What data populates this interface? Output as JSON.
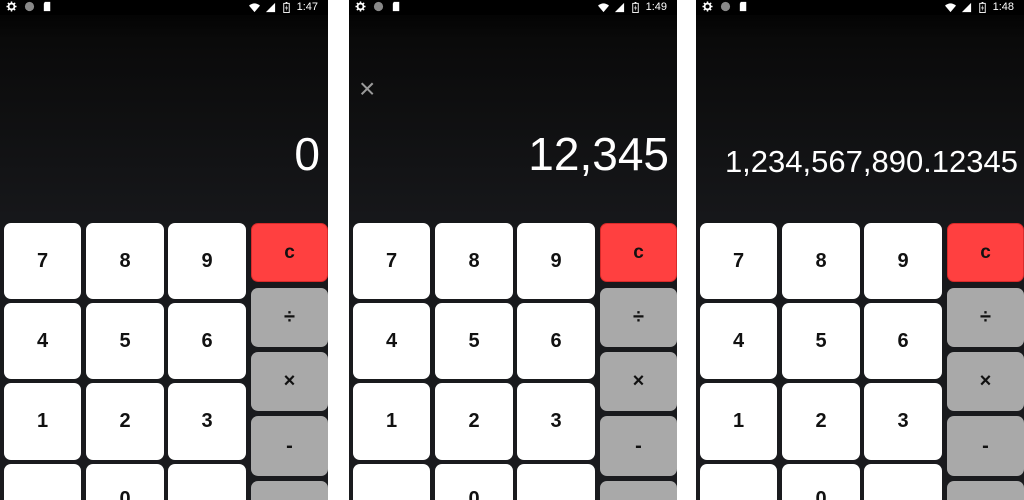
{
  "screens": [
    {
      "status": {
        "time": "1:47"
      },
      "operator": "",
      "display": "0",
      "keys": {
        "k7": "7",
        "k8": "8",
        "k9": "9",
        "clear": "c",
        "k4": "4",
        "k5": "5",
        "k6": "6",
        "divide": "÷",
        "k1": "1",
        "k2": "2",
        "k3": "3",
        "multiply": "×",
        "k0": "0",
        "minus": "-"
      }
    },
    {
      "status": {
        "time": "1:49"
      },
      "operator": "×",
      "display": "12,345",
      "keys": {
        "k7": "7",
        "k8": "8",
        "k9": "9",
        "clear": "c",
        "k4": "4",
        "k5": "5",
        "k6": "6",
        "divide": "÷",
        "k1": "1",
        "k2": "2",
        "k3": "3",
        "multiply": "×",
        "k0": "0",
        "minus": "-"
      }
    },
    {
      "status": {
        "time": "1:48"
      },
      "operator": "",
      "display": "1,234,567,890.12345",
      "keys": {
        "k7": "7",
        "k8": "8",
        "k9": "9",
        "clear": "c",
        "k4": "4",
        "k5": "5",
        "k6": "6",
        "divide": "÷",
        "k1": "1",
        "k2": "2",
        "k3": "3",
        "multiply": "×",
        "k0": "0",
        "minus": "-"
      }
    }
  ],
  "colors": {
    "clear_key": "#ff4040",
    "operator_key": "#a9a9a9",
    "digit_key": "#ffffff",
    "background": "#1a1b1e"
  },
  "icons": {
    "left": [
      "gear-icon",
      "circle-icon",
      "sd-card-icon"
    ],
    "right": [
      "wifi-icon",
      "signal-icon",
      "battery-icon"
    ]
  }
}
